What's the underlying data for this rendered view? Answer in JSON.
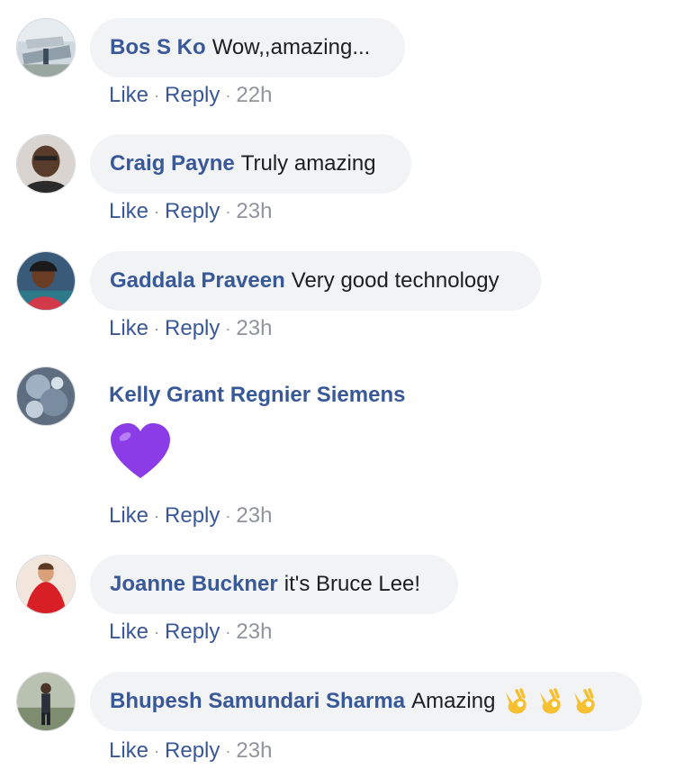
{
  "actions": {
    "like": "Like",
    "reply": "Reply",
    "separator": "·"
  },
  "colors": {
    "name": "#385898",
    "bubble": "#f2f3f5",
    "meta": "#90949c",
    "heart": "#8c3ce6",
    "ok_hand": "#f6c030"
  },
  "comments": [
    {
      "author": "Bos S Ko",
      "text": "Wow,,amazing...",
      "time": "22h"
    },
    {
      "author": "Craig Payne",
      "text": "Truly amazing",
      "time": "23h"
    },
    {
      "author": "Gaddala Praveen",
      "text": "Very good technology",
      "time": "23h"
    },
    {
      "author": "Kelly Grant Regnier Siemens",
      "text": "",
      "sticker": "purple-heart-icon",
      "time": "23h"
    },
    {
      "author": "Joanne Buckner",
      "text": "it's Bruce Lee!",
      "time": "23h"
    },
    {
      "author": "Bhupesh Samundari Sharma",
      "text": "Amazing",
      "emoji": [
        "ok-hand-icon",
        "ok-hand-icon",
        "ok-hand-icon"
      ],
      "time": "23h"
    }
  ]
}
